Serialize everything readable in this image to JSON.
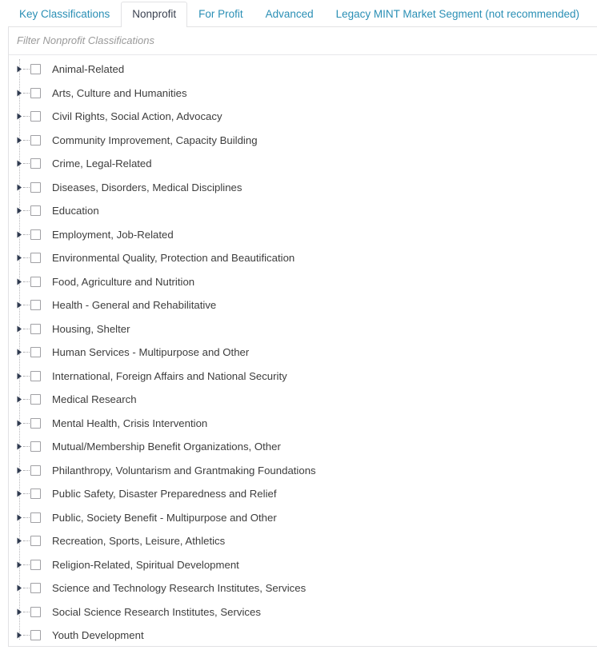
{
  "tabs": [
    {
      "label": "Key Classifications",
      "active": false
    },
    {
      "label": "Nonprofit",
      "active": true
    },
    {
      "label": "For Profit",
      "active": false
    },
    {
      "label": "Advanced",
      "active": false
    },
    {
      "label": "Legacy MINT Market Segment (not recommended)",
      "active": false
    }
  ],
  "filter": {
    "value": "",
    "placeholder": "Filter Nonprofit Classifications"
  },
  "colors": {
    "tab_link": "#2a8fb5",
    "tab_active_text": "#3b4251",
    "border": "#e2e2e4",
    "label_text": "#3d3d3d",
    "placeholder_text": "#9a9a9a",
    "expander_arrow": "#2f3a4f",
    "checkbox_border": "#a0a0a4",
    "tree_line": "#b9b9bd"
  },
  "tree": {
    "expander_icon": "triangle-right-icon",
    "checkbox_icon": "checkbox-unchecked-icon",
    "items": [
      {
        "label": "Animal-Related",
        "checked": false,
        "expanded": false
      },
      {
        "label": "Arts, Culture and Humanities",
        "checked": false,
        "expanded": false
      },
      {
        "label": "Civil Rights, Social Action, Advocacy",
        "checked": false,
        "expanded": false
      },
      {
        "label": "Community Improvement, Capacity Building",
        "checked": false,
        "expanded": false
      },
      {
        "label": "Crime, Legal-Related",
        "checked": false,
        "expanded": false
      },
      {
        "label": "Diseases, Disorders, Medical Disciplines",
        "checked": false,
        "expanded": false
      },
      {
        "label": "Education",
        "checked": false,
        "expanded": false
      },
      {
        "label": "Employment, Job-Related",
        "checked": false,
        "expanded": false
      },
      {
        "label": "Environmental Quality, Protection and Beautification",
        "checked": false,
        "expanded": false
      },
      {
        "label": "Food, Agriculture and Nutrition",
        "checked": false,
        "expanded": false
      },
      {
        "label": "Health - General and Rehabilitative",
        "checked": false,
        "expanded": false
      },
      {
        "label": "Housing, Shelter",
        "checked": false,
        "expanded": false
      },
      {
        "label": "Human Services - Multipurpose and Other",
        "checked": false,
        "expanded": false
      },
      {
        "label": "International, Foreign Affairs and National Security",
        "checked": false,
        "expanded": false
      },
      {
        "label": "Medical Research",
        "checked": false,
        "expanded": false
      },
      {
        "label": "Mental Health, Crisis Intervention",
        "checked": false,
        "expanded": false
      },
      {
        "label": "Mutual/Membership Benefit Organizations, Other",
        "checked": false,
        "expanded": false
      },
      {
        "label": "Philanthropy, Voluntarism and Grantmaking Foundations",
        "checked": false,
        "expanded": false
      },
      {
        "label": "Public Safety, Disaster Preparedness and Relief",
        "checked": false,
        "expanded": false
      },
      {
        "label": "Public, Society Benefit - Multipurpose and Other",
        "checked": false,
        "expanded": false
      },
      {
        "label": "Recreation, Sports, Leisure, Athletics",
        "checked": false,
        "expanded": false
      },
      {
        "label": "Religion-Related, Spiritual Development",
        "checked": false,
        "expanded": false
      },
      {
        "label": "Science and Technology Research Institutes, Services",
        "checked": false,
        "expanded": false
      },
      {
        "label": "Social Science Research Institutes, Services",
        "checked": false,
        "expanded": false
      },
      {
        "label": "Youth Development",
        "checked": false,
        "expanded": false
      }
    ]
  }
}
